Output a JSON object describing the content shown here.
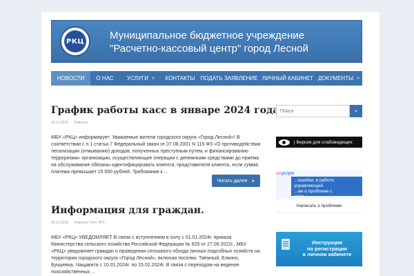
{
  "header": {
    "logo_text": "РКЦ",
    "title_line1": "Муниципальное бюджетное учреждение",
    "title_line2": "\"Расчетно-кассовый центр\" город Лесной"
  },
  "nav": {
    "items": [
      {
        "label": "НОВОСТИ",
        "active": true
      },
      {
        "label": "О НАС"
      },
      {
        "label": "УСЛУГИ",
        "dropdown": "»"
      },
      {
        "label": "КОНТАКТЫ"
      },
      {
        "label": "ПОДАТЬ ЗАЯВЛЕНИЕ"
      },
      {
        "label": "ЛИЧНЫЙ КАБИНЕТ"
      },
      {
        "label": "ДОКУМЕНТЫ",
        "dropdown": "»"
      }
    ]
  },
  "posts": [
    {
      "title": "График работы касс в январе 2024 года",
      "date": "28.12.2023",
      "categories": "Новости",
      "excerpt": "МБУ «РКЦ» информирует: Уважаемые жители городского округа «Город Лесной»! В соответствии с п.1 статьи 7 Федеральный закон от 07.08.2001 N 115-ФЗ «О противодействии легализации (отмыванию) доходов, полученных преступным путем, и финансированию терроризма» организации, осуществляющие операции с денежными средствами до приема на обслуживание обязаны идентифицировать клиента, представителя клиента, если сумма платежа превышает 15 000 рублей. Требования к ...",
      "read_more": "Читать далее",
      "read_more_icon": "➤"
    },
    {
      "title": "Информация для граждан.",
      "date": "28.12.2023",
      "categories": "Новости, Учет ЛПХ",
      "excerpt": "МБУ «РКЦ» УВЕДОМЛЯЕТ В связи с вступлением в силу с 01.01.2024г. приказа Министерства сельского хозяйства Российской Федерации № 629 от 27.09.2022г., МБУ «РКЦ» уведомляет граждан о проведении сплошного обхода личных подсобных хозяйств на территории городского округа «Город Лесной», включая поселки: Таёжный, Елкино, Бушуевка, Чащавита с 10.01.2024г. по 15.02.2024г. В связи с переходом на ведение похозяйственных ..."
    }
  ],
  "sidebar": {
    "search_placeholder": "Поиск",
    "search_icon": "»",
    "accessibility_label": "| Версия для слабовидящих",
    "gos_logo_part1": "гос",
    "gos_logo_part2": "услуги",
    "gos_popup_line1": "...ошибки, в работе управляющей",
    "gos_popup_line2": "...ам о проблеме с",
    "gos_popup_line3": "ЖКХ",
    "gos_button": "Написать о проблеме",
    "banner_line1": "Инструкция",
    "banner_line2": "по регистрации",
    "banner_line3": "в личном кабинете"
  },
  "colors": {
    "header_bg": "#3a70aa",
    "nav_bg": "#3c74b0",
    "nav_active": "#5e90c4",
    "button_bg": "#3a70aa",
    "page_bg": "#e9eef5"
  }
}
